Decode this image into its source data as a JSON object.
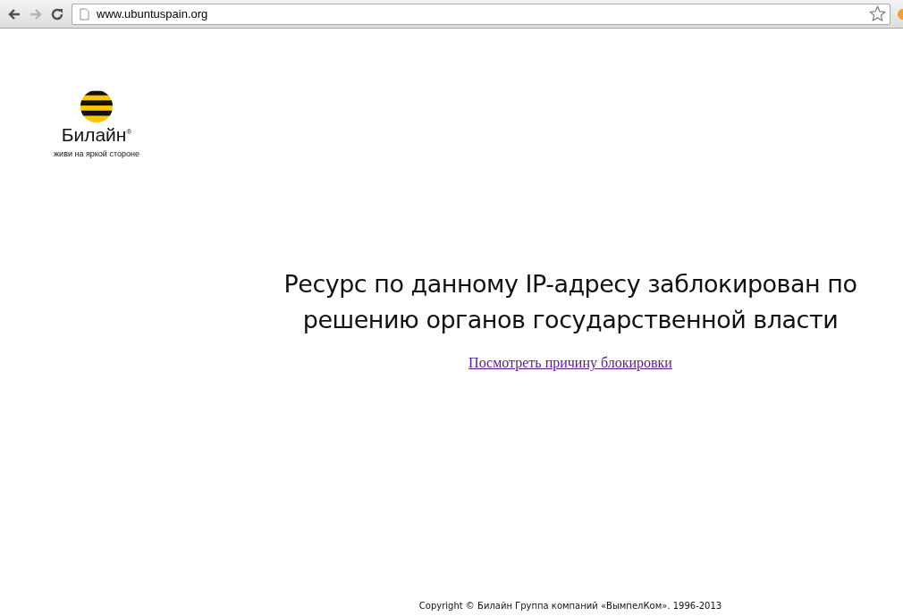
{
  "browser": {
    "url": "www.ubuntuspain.org",
    "back_enabled": true,
    "forward_enabled": false
  },
  "logo": {
    "name": "Билайн$^{®}$",
    "slogan": "живи на яркой стороне"
  },
  "message": {
    "heading": "Ресурс по данному IP-адресу заблокирован по решению органов государственной власти",
    "link": "Посмотреть причину блокировки"
  },
  "footer": "Copyright © Билайн Группа компаний «ВымпелКом». 1996-2013"
}
